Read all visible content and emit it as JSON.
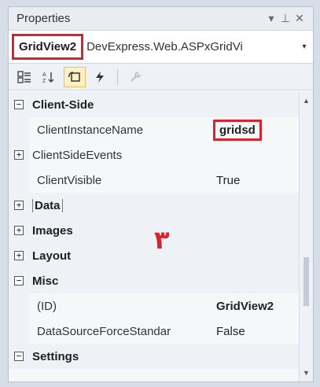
{
  "title": "Properties",
  "window_controls": {
    "dropdown": "▾",
    "pin": "⊥",
    "close": "✕"
  },
  "object_selector": {
    "name": "GridView2",
    "type": "DevExpress.Web.ASPxGridVi",
    "dropdown": "▾"
  },
  "toolbar": [
    "categorized",
    "alphabetical",
    "properties",
    "events",
    "property-pages"
  ],
  "grid": {
    "client_side": {
      "label": "Client-Side",
      "expander": "−"
    },
    "client_instance_name": {
      "name": "ClientInstanceName",
      "value": "gridsd"
    },
    "client_side_events": {
      "name": "ClientSideEvents",
      "expander": "+"
    },
    "client_visible": {
      "name": "ClientVisible",
      "value": "True"
    },
    "data": {
      "label": "Data",
      "expander": "+"
    },
    "images": {
      "label": "Images",
      "expander": "+"
    },
    "layout": {
      "label": "Layout",
      "expander": "+"
    },
    "misc": {
      "label": "Misc",
      "expander": "−"
    },
    "id": {
      "name": "(ID)",
      "value": "GridView2"
    },
    "data_source_force": {
      "name": "DataSourceForceStandar",
      "value": "False"
    },
    "settings": {
      "label": "Settings",
      "expander": "−"
    }
  },
  "annotation": "۳",
  "accent_color": "#d4242f"
}
